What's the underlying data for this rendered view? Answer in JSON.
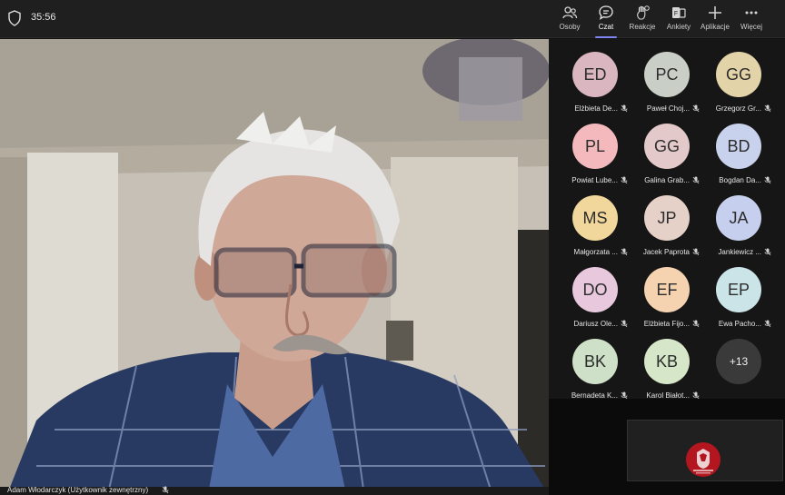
{
  "meeting": {
    "timer": "35:56",
    "toolbar": [
      {
        "id": "people",
        "label": "Osoby",
        "icon": "people-icon"
      },
      {
        "id": "chat",
        "label": "Czat",
        "icon": "chat-icon"
      },
      {
        "id": "reactions",
        "label": "Reakcje",
        "icon": "reactions-icon"
      },
      {
        "id": "polls",
        "label": "Ankiety",
        "icon": "polls-icon"
      },
      {
        "id": "apps",
        "label": "Aplikacje",
        "icon": "plus-icon"
      },
      {
        "id": "more",
        "label": "Więcej",
        "icon": "ellipsis-icon"
      }
    ],
    "active_tab": "Czat"
  },
  "main_video": {
    "caption": "Adam Włodarczyk (Użytkownik zewnętrzny)"
  },
  "participants": [
    {
      "initials": "ED",
      "name": "Elżbieta De...",
      "color": "#d9b6c0"
    },
    {
      "initials": "PC",
      "name": "Paweł Choj...",
      "color": "#c9cfc7"
    },
    {
      "initials": "GG",
      "name": "Grzegorz Gr...",
      "color": "#e3d3a8"
    },
    {
      "initials": "PL",
      "name": "Powiat Lube...",
      "color": "#f3b9bd"
    },
    {
      "initials": "GG",
      "name": "Galina Grab...",
      "color": "#e3c9c9"
    },
    {
      "initials": "BD",
      "name": "Bogdan Da...",
      "color": "#c8d2ec"
    },
    {
      "initials": "MS",
      "name": "Małgorzata ...",
      "color": "#f1d79b"
    },
    {
      "initials": "JP",
      "name": "Jacek Paprota",
      "color": "#e6d1c8"
    },
    {
      "initials": "JA",
      "name": "Jankiewicz ...",
      "color": "#c6d0ee"
    },
    {
      "initials": "DO",
      "name": "Dariusz Ole...",
      "color": "#e7c8dc"
    },
    {
      "initials": "EF",
      "name": "Elżbieta Fijo...",
      "color": "#f6d3b0"
    },
    {
      "initials": "EP",
      "name": "Ewa Pacho...",
      "color": "#cbe4e8"
    },
    {
      "initials": "BK",
      "name": "Bernadeta K...",
      "color": "#cfe0c8"
    },
    {
      "initials": "KB",
      "name": "Karol Białot...",
      "color": "#d5e6c9"
    }
  ],
  "more_participants": "+13"
}
